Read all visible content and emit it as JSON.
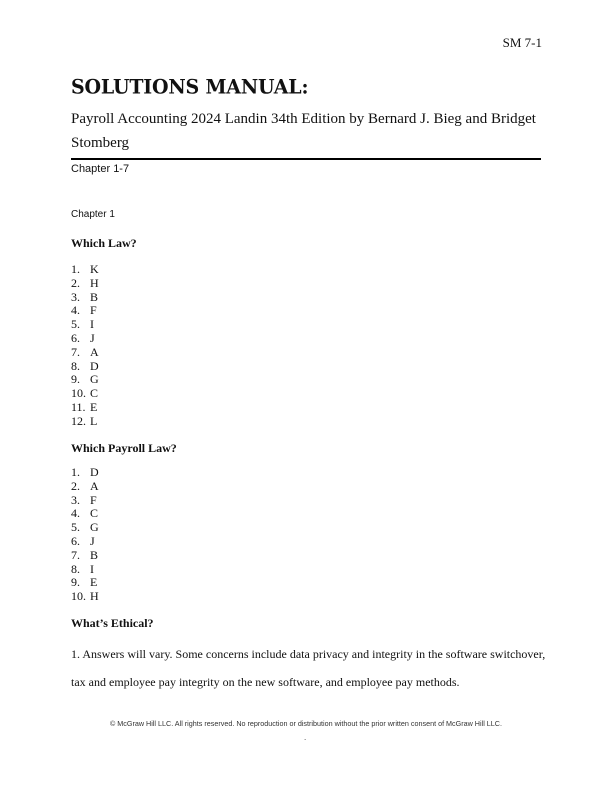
{
  "header": {
    "page_number": "SM 7-1"
  },
  "title": "SOLUTIONS MANUAL:",
  "subtitle": "Payroll Accounting 2024 Landin 34th Edition by Bernard J. Bieg and Bridget Stomberg",
  "chapter_range": "Chapter 1-7",
  "chapter_label": "Chapter 1",
  "sections": [
    {
      "heading": "Which Law?",
      "items": [
        {
          "num": "1.",
          "answer": "K"
        },
        {
          "num": "2.",
          "answer": "H"
        },
        {
          "num": "3.",
          "answer": "B"
        },
        {
          "num": "4.",
          "answer": "F"
        },
        {
          "num": "5.",
          "answer": "I"
        },
        {
          "num": "6.",
          "answer": "J"
        },
        {
          "num": "7.",
          "answer": "A"
        },
        {
          "num": "8.",
          "answer": "D"
        },
        {
          "num": "9.",
          "answer": "G"
        },
        {
          "num": "10.",
          "answer": "C"
        },
        {
          "num": "11.",
          "answer": "E"
        },
        {
          "num": "12.",
          "answer": "L"
        }
      ]
    },
    {
      "heading": "Which Payroll Law?",
      "items": [
        {
          "num": "1.",
          "answer": "D"
        },
        {
          "num": "2.",
          "answer": "A"
        },
        {
          "num": "3.",
          "answer": "F"
        },
        {
          "num": "4.",
          "answer": "C"
        },
        {
          "num": "5.",
          "answer": "G"
        },
        {
          "num": "6.",
          "answer": "J"
        },
        {
          "num": "7.",
          "answer": "B"
        },
        {
          "num": "8.",
          "answer": "I"
        },
        {
          "num": "9.",
          "answer": "E"
        },
        {
          "num": "10.",
          "answer": "H"
        }
      ]
    },
    {
      "heading": "What’s Ethical?",
      "paragraph": "1.  Answers will vary. Some concerns include data privacy and integrity in the software switchover, tax and employee pay integrity on the new software, and employee pay methods."
    }
  ],
  "footer": {
    "copyright": "© McGraw Hill LLC. All rights reserved. No reproduction or distribution without the prior written consent of McGraw Hill LLC.",
    "mark": "."
  }
}
